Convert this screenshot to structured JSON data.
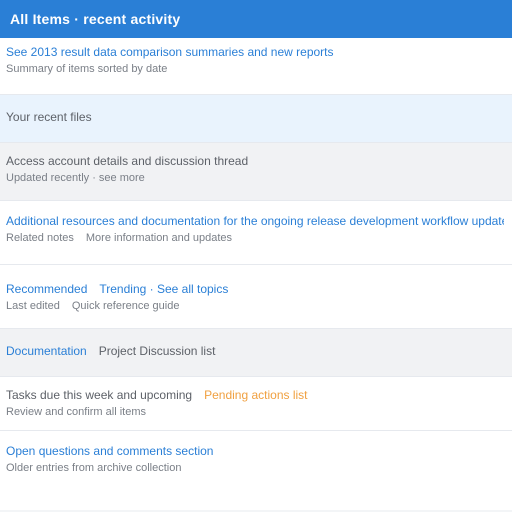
{
  "header": {
    "title": "All Items · recent activity"
  },
  "rows": [
    {
      "primary": "See 2013 result data comparison summaries and new reports",
      "secondary": "Summary of items sorted by date"
    },
    {
      "primary": "Your recent files"
    },
    {
      "primary": "Access account details and discussion thread",
      "secondary": "Updated recently · see more"
    },
    {
      "primary": "Additional resources and documentation for the ongoing release development workflow update",
      "secondary_a": "Related notes",
      "secondary_b": "More information and updates"
    },
    {
      "primary_a": "Recommended",
      "primary_b": "Trending · See all topics",
      "secondary_a": "Last edited",
      "secondary_b": "Quick reference guide"
    },
    {
      "primary_a": "Documentation",
      "primary_b": "Project Discussion list"
    },
    {
      "primary_a": "Tasks due this week and upcoming",
      "primary_b": "Pending actions list",
      "secondary": "Review and confirm all items"
    },
    {
      "primary": "Open questions and comments section",
      "secondary": "Older entries from archive collection"
    }
  ],
  "colors": {
    "accent": "#2a7fd6",
    "highlight": "#f0a040",
    "selected_bg": "#e9f3fd"
  }
}
